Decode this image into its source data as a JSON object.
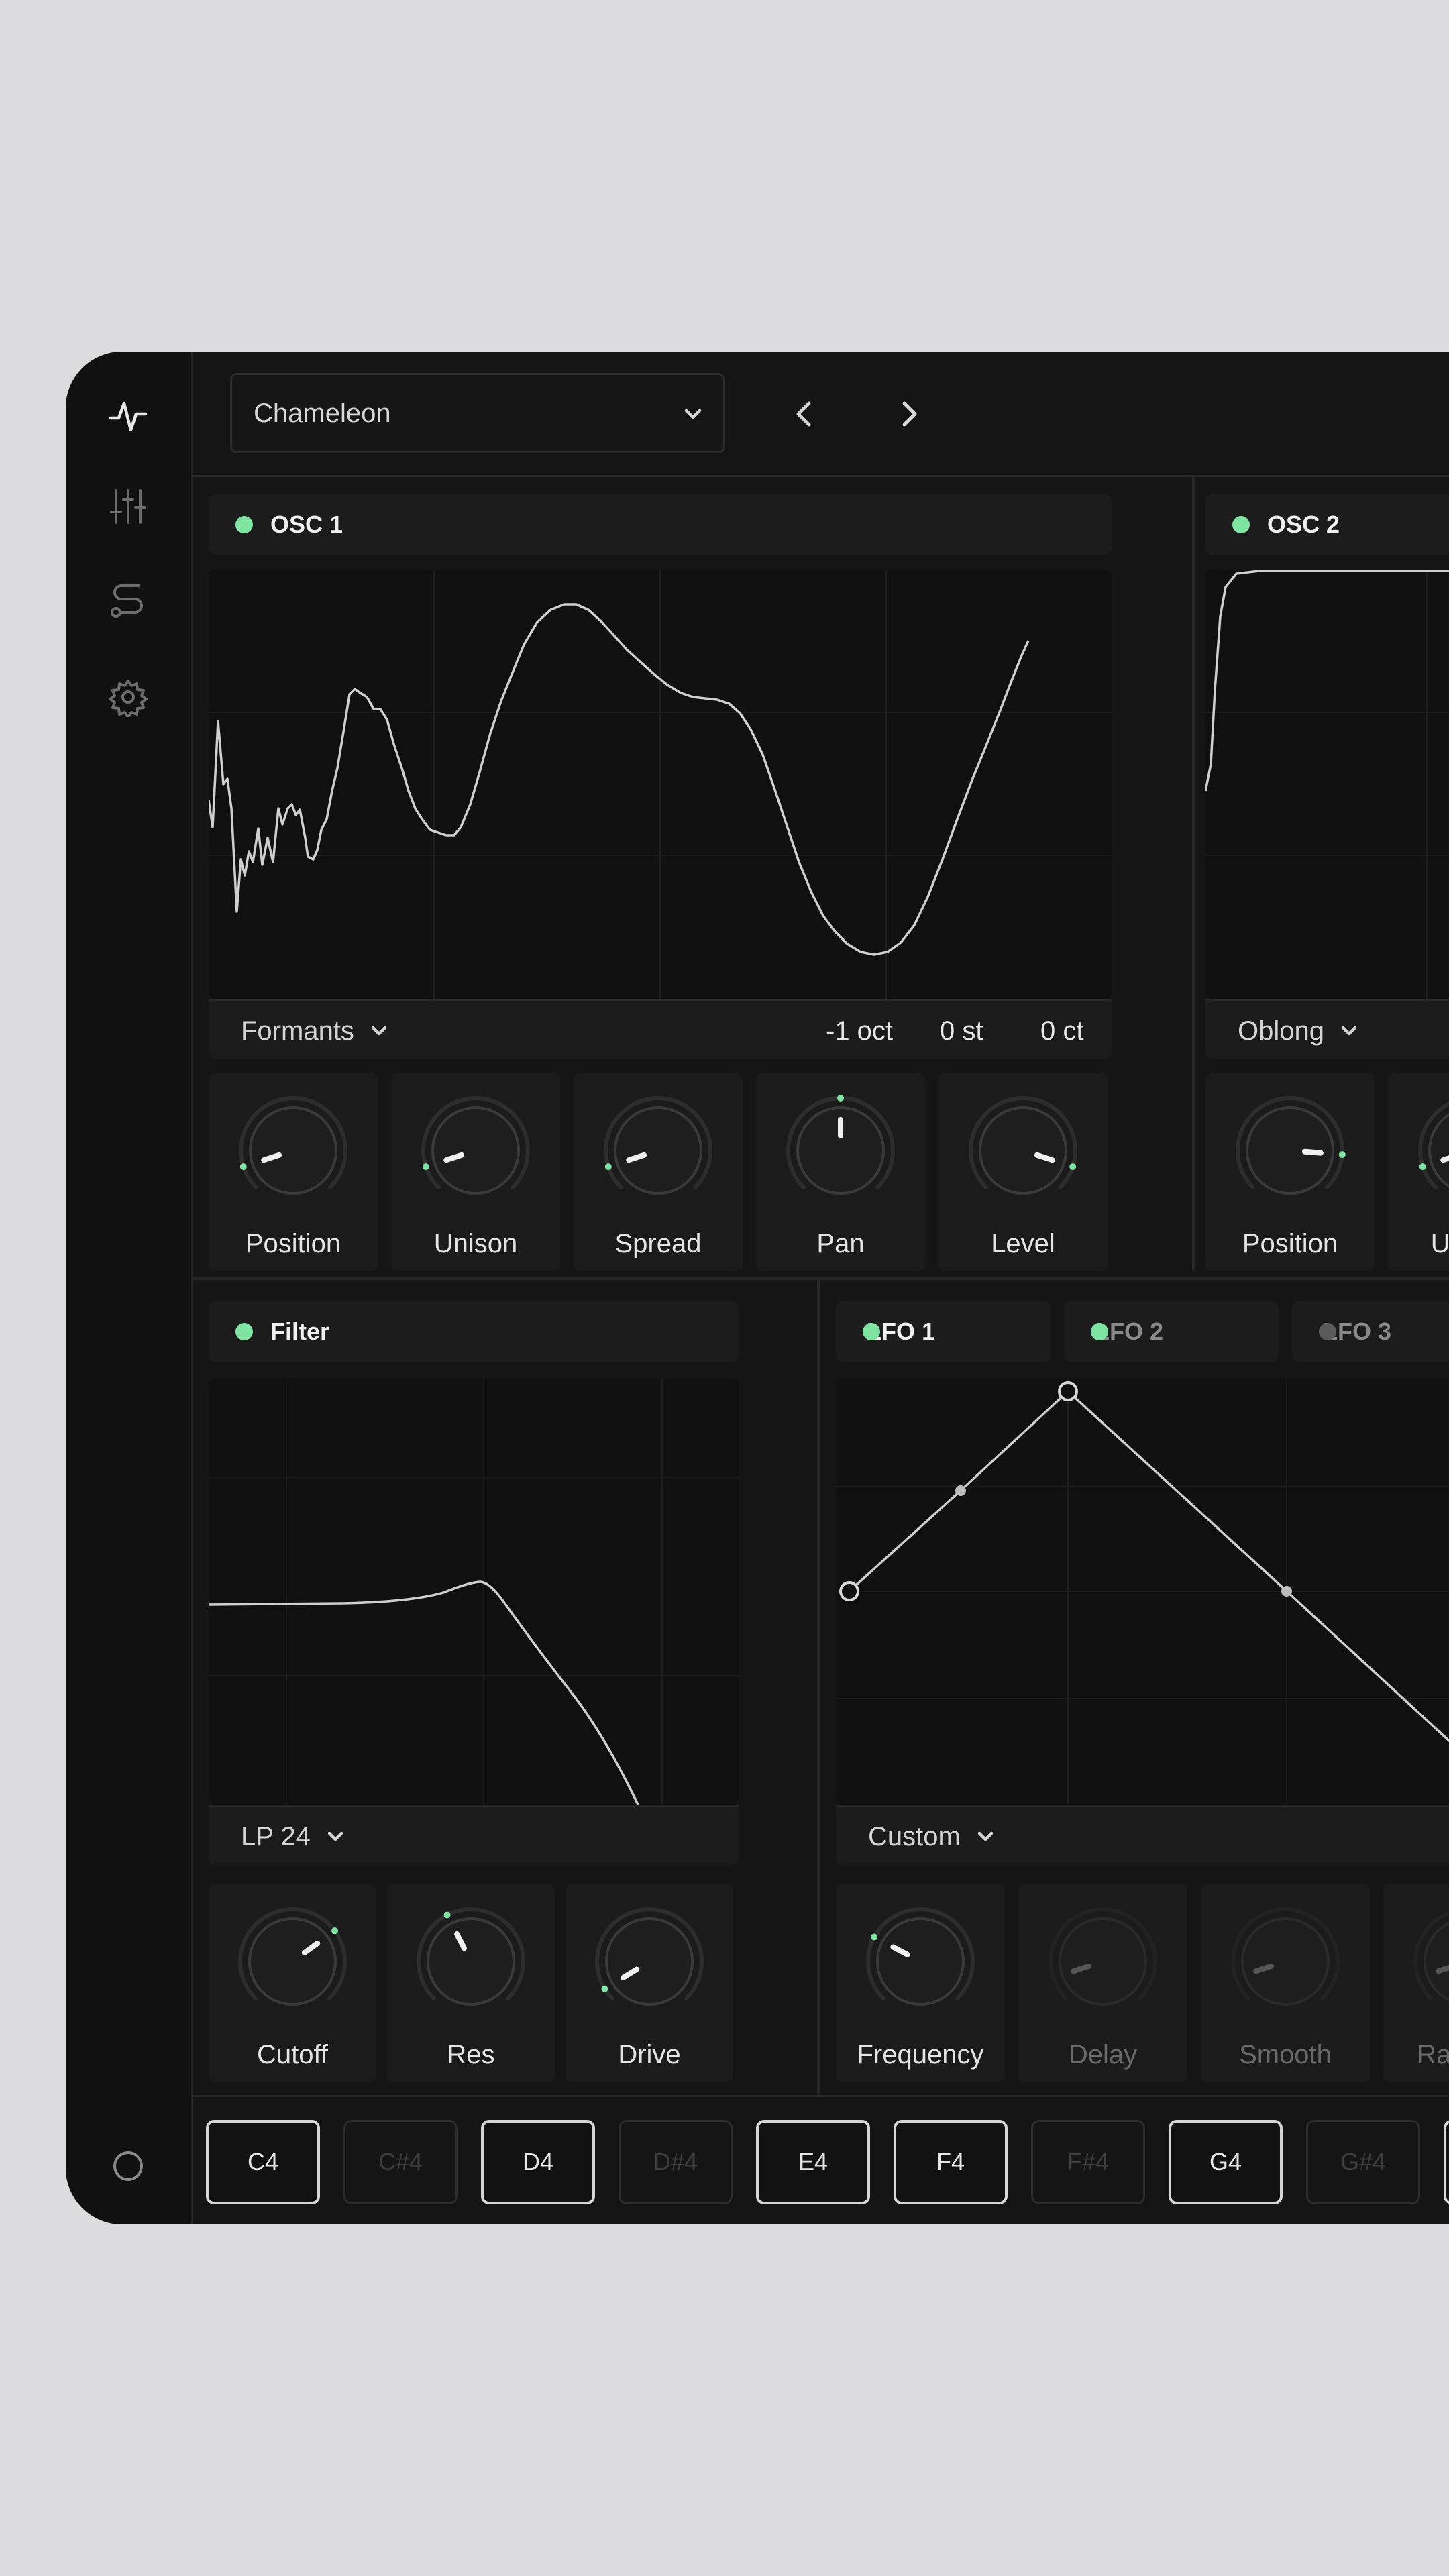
{
  "preset": {
    "name": "Chameleon"
  },
  "colors": {
    "accent": "#7fe3a1",
    "inactive": "#5a5a5a",
    "curve": "#c8c8c8"
  },
  "rail": {
    "icons": [
      "waveform-icon",
      "sliders-icon",
      "routing-icon",
      "gear-icon",
      "circle-icon"
    ]
  },
  "osc1": {
    "title": "OSC 1",
    "waveform": "Formants",
    "tuning": {
      "octave": "-1 oct",
      "semitone": "0 st",
      "cents": "0 ct"
    },
    "knobs": [
      {
        "label": "Position",
        "value": 0.1
      },
      {
        "label": "Unison",
        "value": 0.1
      },
      {
        "label": "Spread",
        "value": 0.1
      },
      {
        "label": "Pan",
        "value": 0.5
      },
      {
        "label": "Level",
        "value": 0.9
      }
    ]
  },
  "osc2": {
    "title": "OSC 2",
    "waveform": "Oblong",
    "knobs": [
      {
        "label": "Position",
        "value": 0.85
      },
      {
        "label": "Unison",
        "value": 0.1
      }
    ]
  },
  "filter": {
    "title": "Filter",
    "type": "LP 24",
    "knobs": [
      {
        "label": "Cutoff",
        "value": 0.7
      },
      {
        "label": "Res",
        "value": 0.4
      },
      {
        "label": "Drive",
        "value": 0.05
      }
    ]
  },
  "lfo": {
    "tabs": [
      {
        "label": "LFO 1",
        "active": true
      },
      {
        "label": "LFO 2",
        "active": false
      },
      {
        "label": "LFO 3",
        "active": false
      }
    ],
    "shape": "Custom",
    "knobs": [
      {
        "label": "Frequency",
        "value": 0.27,
        "enabled": true
      },
      {
        "label": "Delay",
        "value": 0.1,
        "enabled": false
      },
      {
        "label": "Smooth",
        "value": 0.1,
        "enabled": false
      },
      {
        "label": "Random",
        "value": 0.1,
        "enabled": false
      }
    ]
  },
  "keyboard": {
    "keys": [
      {
        "note": "C4",
        "enabled": true
      },
      {
        "note": "C#4",
        "enabled": false
      },
      {
        "note": "D4",
        "enabled": true
      },
      {
        "note": "D#4",
        "enabled": false
      },
      {
        "note": "E4",
        "enabled": true
      },
      {
        "note": "F4",
        "enabled": true
      },
      {
        "note": "F#4",
        "enabled": false
      },
      {
        "note": "G4",
        "enabled": true
      },
      {
        "note": "G#4",
        "enabled": false
      }
    ]
  }
}
